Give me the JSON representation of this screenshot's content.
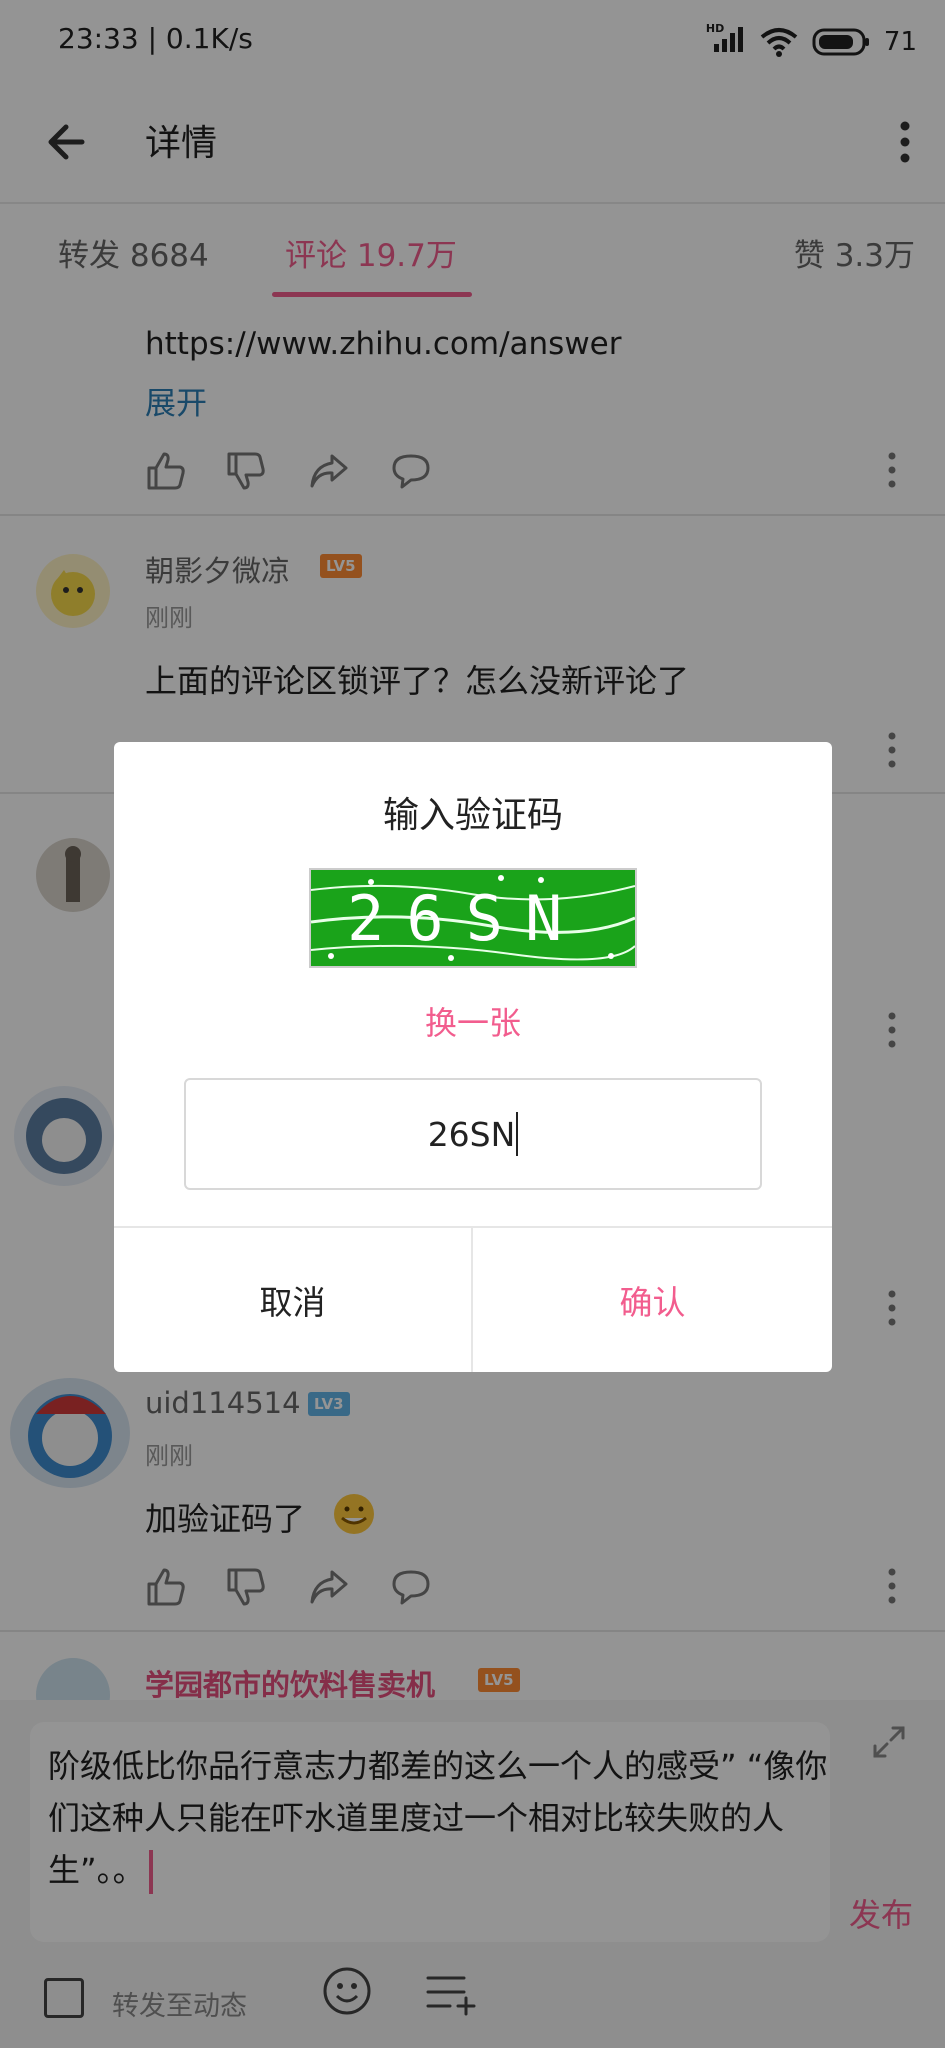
{
  "status_bar": {
    "time_speed": "23:33 | 0.1K/s",
    "network_badge": "HD",
    "battery": "71"
  },
  "header": {
    "title": "详情",
    "back_icon": "arrow-left-icon",
    "more_icon": "more-vertical-icon"
  },
  "tabs": {
    "repost": "转发 8684",
    "comment": "评论 19.7万",
    "like": "赞 3.3万",
    "active_color": "#f25d8e"
  },
  "comments": [
    {
      "text_line1": "https://www.zhihu.com/answer",
      "expand": "展开"
    },
    {
      "user": "朝影夕微凉",
      "level": "LV5",
      "time": "刚刚",
      "text": "上面的评论区锁评了？怎么没新评论了"
    },
    {
      "user": "uid114514",
      "level": "LV3",
      "time": "刚刚",
      "text": "加验证码了"
    },
    {
      "user": "学园都市的饮料售卖机",
      "level": "LV5"
    }
  ],
  "composer": {
    "text": "阶级低比你品行意志力都差的这么一个人的感受” “像你们这种人只能在吓水道里度过一个相对比较失败的人生”。。",
    "publish": "发布",
    "repost_label": "转发至动态"
  },
  "dialog": {
    "title": "输入验证码",
    "captcha_text": "26SN",
    "refresh": "换一张",
    "input_value": "26SN",
    "cancel": "取消",
    "confirm": "确认"
  }
}
